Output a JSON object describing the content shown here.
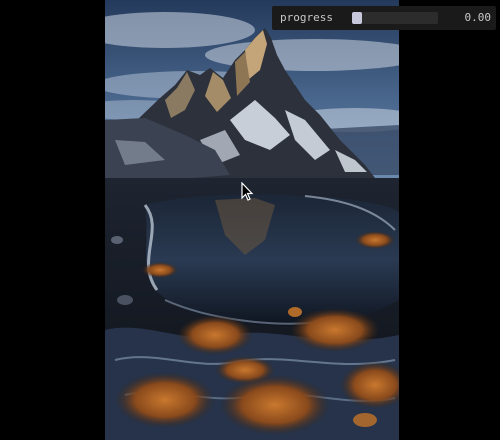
{
  "gui": {
    "label": "progress",
    "value_text": "0.00",
    "progress": 0.0,
    "accent": "#2cc9ff",
    "panel_color": "#1a1a1a"
  },
  "canvas": {
    "background": "#000000",
    "image_subject": "mountain-lake-photo"
  },
  "cursor": {
    "icon": "arrow-cursor-icon"
  }
}
